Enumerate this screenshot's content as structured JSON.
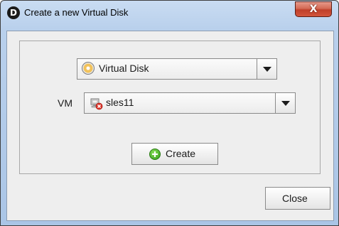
{
  "window": {
    "title": "Create a new Virtual Disk",
    "app_icon_letter": "D",
    "close_glyph": "X"
  },
  "type_combo": {
    "value": "Virtual Disk",
    "icon": "virtual-disk-icon"
  },
  "vm_combo": {
    "label": "VM",
    "value": "sles11",
    "icon": "vm-error-icon"
  },
  "buttons": {
    "create_label": "Create",
    "create_icon": "plus-circle-icon",
    "close_label": "Close"
  },
  "colors": {
    "title_gradient_top": "#c9dcf2",
    "close_button_red": "#c0402a",
    "panel_background": "#eeeeee",
    "create_icon_green": "#2f9a16"
  }
}
